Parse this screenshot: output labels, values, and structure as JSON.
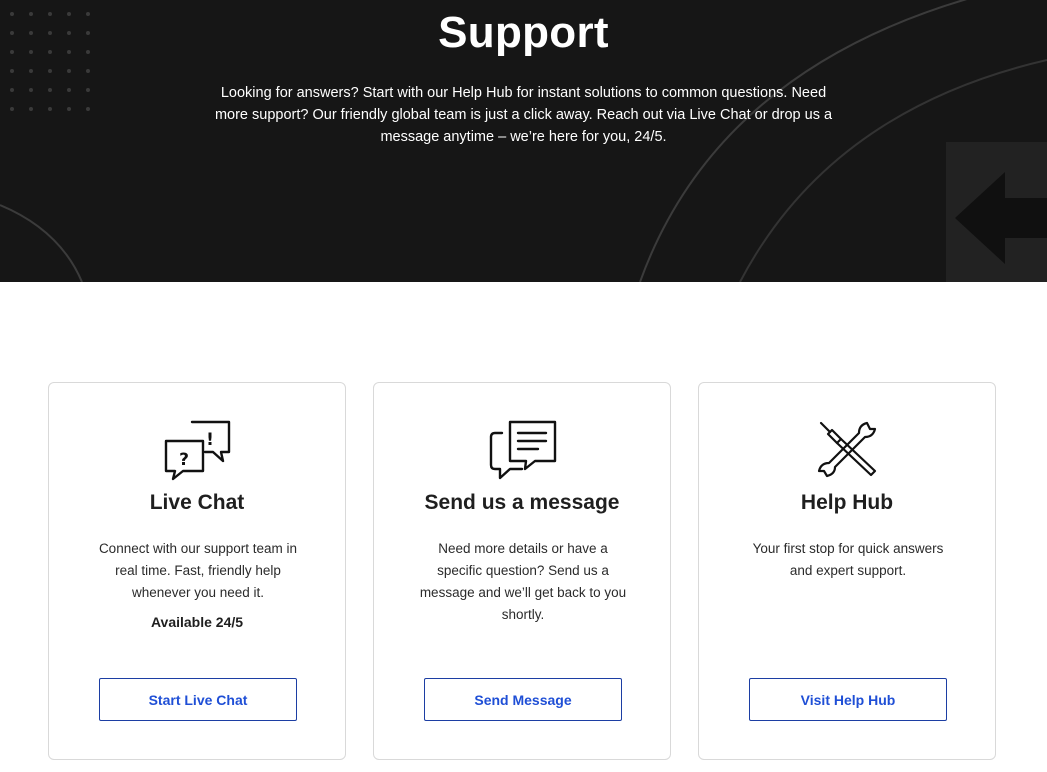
{
  "hero": {
    "title": "Support",
    "description": "Looking for answers? Start with our Help Hub for instant solutions to common questions. Need more support? Our friendly global team is just a click away. Reach out via Live Chat or drop us a message anytime – we’re here for you, 24/5.",
    "background_color": "#161616"
  },
  "cards": [
    {
      "icon": "chat-bubbles-icon",
      "title": "Live Chat",
      "description": "Connect with our support team in real time. Fast, friendly help whenever you need it.",
      "note": "Available 24/5",
      "button_label": "Start Live Chat"
    },
    {
      "icon": "message-icon",
      "title": "Send us a message",
      "description": "Need more details or have a specific question? Send us a message and we’ll get back to you shortly.",
      "button_label": "Send Message"
    },
    {
      "icon": "tools-icon",
      "title": "Help Hub",
      "description": "Your first stop for quick answers and expert support.",
      "button_label": "Visit Help Hub"
    }
  ],
  "colors": {
    "accent": "#1f4fd6",
    "button_border": "#1c3ea3",
    "card_border": "#d9d9d9",
    "text": "#1f1f1f"
  }
}
